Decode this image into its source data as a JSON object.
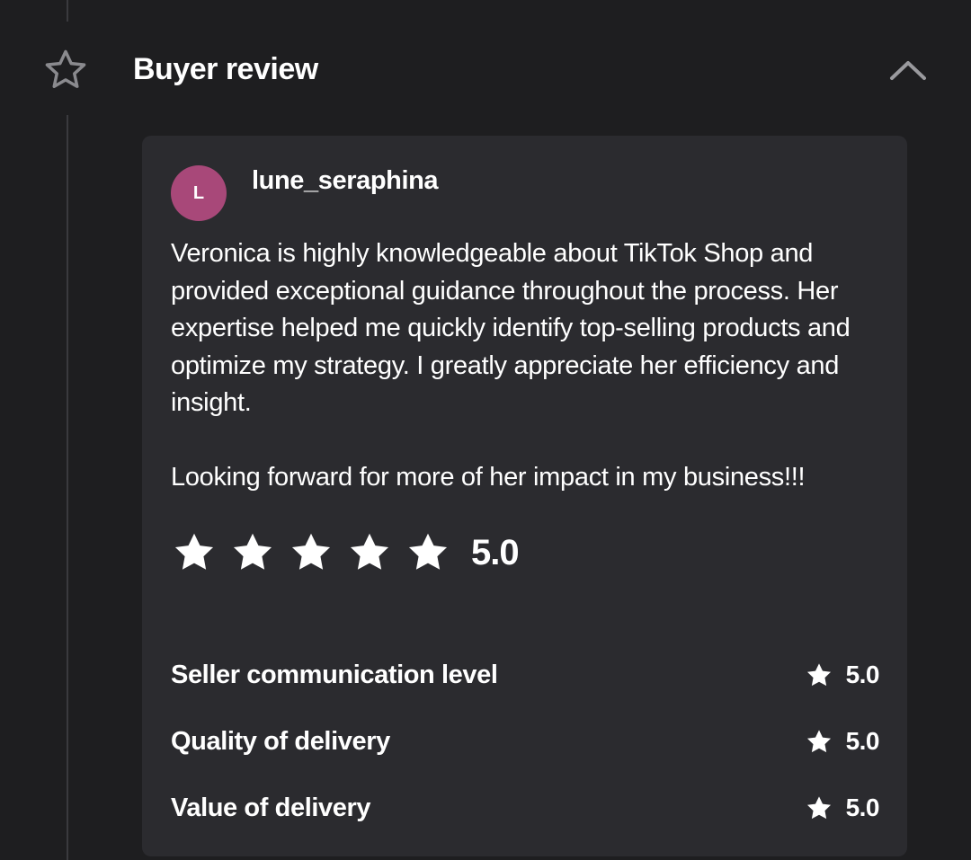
{
  "section": {
    "title": "Buyer review",
    "header_icon": "star-outline-icon",
    "collapse_icon": "chevron-up-icon"
  },
  "review": {
    "avatar_initial": "L",
    "avatar_color": "#a84879",
    "username": "lune_seraphina",
    "paragraphs": [
      "Veronica is highly knowledgeable about TikTok Shop and provided exceptional guidance throughout the process. Her expertise helped me quickly identify top-selling products and optimize my strategy. I greatly appreciate her efficiency and insight.",
      "Looking forward for more of her impact in my business!!!"
    ],
    "stars": 5,
    "overall_score": "5.0",
    "ratings": [
      {
        "label": "Seller communication level",
        "value": "5.0"
      },
      {
        "label": "Quality of delivery",
        "value": "5.0"
      },
      {
        "label": "Value of delivery",
        "value": "5.0"
      }
    ]
  },
  "colors": {
    "background": "#1e1e20",
    "card": "#2b2b2f",
    "text": "#ffffff",
    "muted_icon": "#8a8a8e"
  }
}
